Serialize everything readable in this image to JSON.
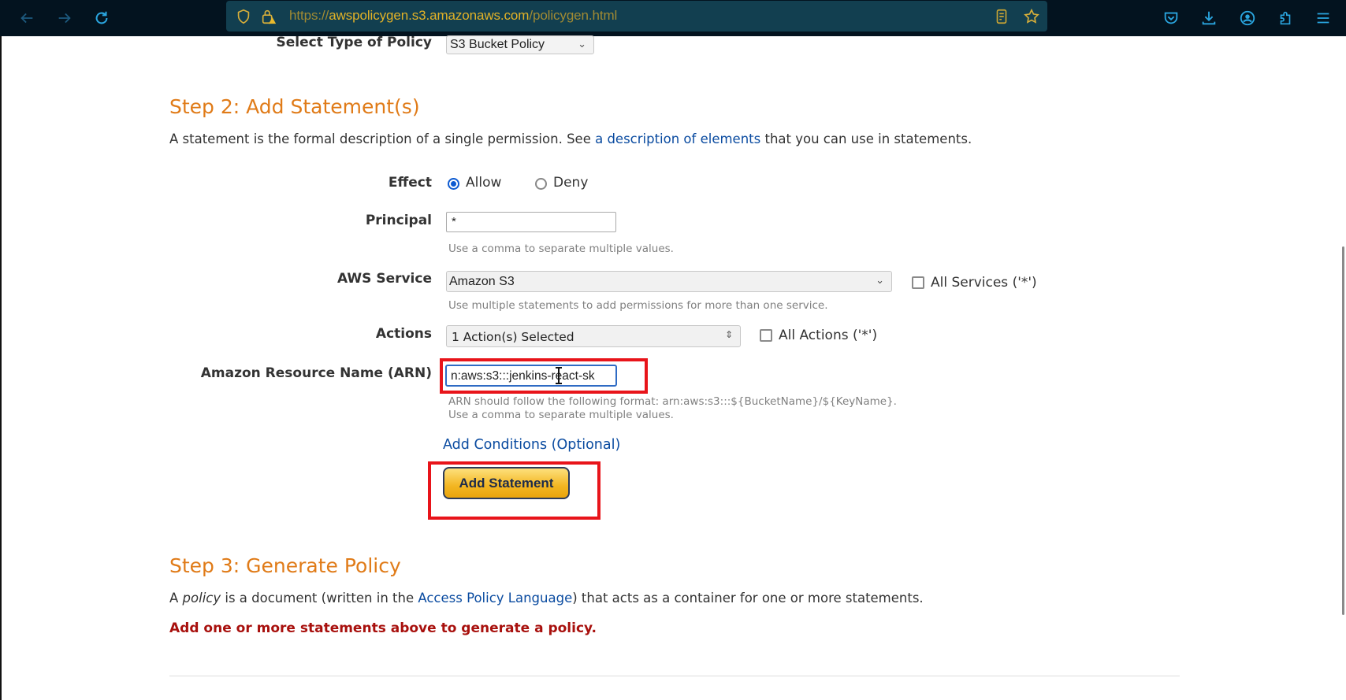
{
  "browser": {
    "url_prefix": "https://",
    "url_host": "awspolicygen.s3.amazonaws.com",
    "url_path": "/policygen.html",
    "icons": [
      "back-icon",
      "forward-icon",
      "reload-icon",
      "shield-icon",
      "lock-warning-icon",
      "reader-view-icon",
      "bookmark-star-icon",
      "pocket-icon",
      "downloads-icon",
      "account-icon",
      "extensions-icon",
      "menu-icon"
    ]
  },
  "step1": {
    "policy_type_label": "Select Type of Policy",
    "policy_type_value": "S3 Bucket Policy"
  },
  "step2": {
    "heading": "Step 2: Add Statement(s)",
    "intro_before": "A statement is the formal description of a single permission. See ",
    "intro_link": "a description of elements",
    "intro_after": " that you can use in statements.",
    "effect": {
      "label": "Effect",
      "options": [
        {
          "label": "Allow",
          "checked": true
        },
        {
          "label": "Deny",
          "checked": false
        }
      ]
    },
    "principal": {
      "label": "Principal",
      "value": "*",
      "hint": "Use a comma to separate multiple values."
    },
    "aws_service": {
      "label": "AWS Service",
      "value": "Amazon S3",
      "hint": "Use multiple statements to add permissions for more than one service.",
      "all_label": "All Services ('*')",
      "all_checked": false
    },
    "actions": {
      "label": "Actions",
      "value": "1 Action(s) Selected",
      "all_label": "All Actions ('*')",
      "all_checked": false
    },
    "arn": {
      "label": "Amazon Resource Name (ARN)",
      "value": "n:aws:s3:::jenkins-react-sk",
      "hint_line1": "ARN should follow the following format: arn:aws:s3:::${BucketName}/${KeyName}.",
      "hint_line2": "Use a comma to separate multiple values."
    },
    "add_conditions_link": "Add Conditions (Optional)",
    "add_statement_button": "Add Statement"
  },
  "step3": {
    "heading": "Step 3: Generate Policy",
    "intro_before": "A ",
    "intro_em": "policy",
    "intro_middle": " is a document (written in the ",
    "intro_link": "Access Policy Language",
    "intro_after": ") that acts as a container for one or more statements.",
    "error": "Add one or more statements above to generate a policy."
  },
  "colors": {
    "heading_orange": "#e07b18",
    "link_blue": "#0a4ba0",
    "error_red": "#a8100d",
    "highlight_red": "#e8141a",
    "button_gold": "#f3b622"
  }
}
